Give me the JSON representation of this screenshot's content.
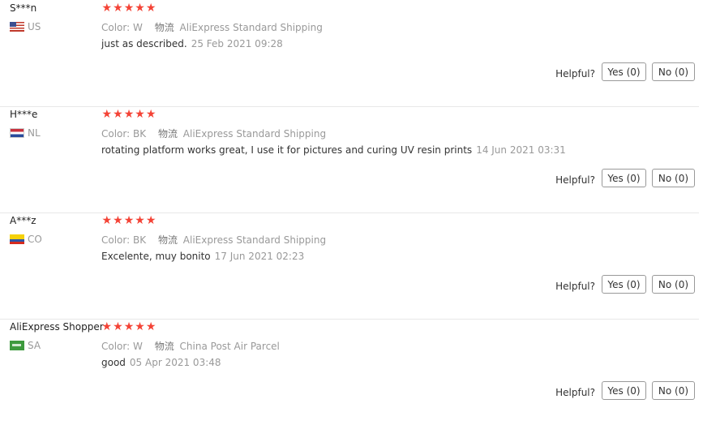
{
  "labels": {
    "color": "Color:",
    "logistics": "物流",
    "helpful": "Helpful?"
  },
  "colors": {
    "star": "#f44336",
    "muted": "#999999",
    "border": "#999999",
    "separator": "#e8e8e8"
  },
  "reviews": [
    {
      "user": "S***n",
      "country": "US",
      "flag_icon": "us-flag-icon",
      "stars": 5,
      "color": "W",
      "shipping": "AliExpress Standard Shipping",
      "text": "just as described.",
      "date": "25 Feb 2021 09:28",
      "yes": "Yes (0)",
      "no": "No (0)"
    },
    {
      "user": "H***e",
      "country": "NL",
      "flag_icon": "nl-flag-icon",
      "stars": 5,
      "color": "BK",
      "shipping": "AliExpress Standard Shipping",
      "text": "rotating platform works great, I use it for pictures and curing UV resin prints",
      "date": "14 Jun 2021 03:31",
      "yes": "Yes (0)",
      "no": "No (0)"
    },
    {
      "user": "A***z",
      "country": "CO",
      "flag_icon": "co-flag-icon",
      "stars": 5,
      "color": "BK",
      "shipping": "AliExpress Standard Shipping",
      "text": "Excelente, muy bonito",
      "date": "17 Jun 2021 02:23",
      "yes": "Yes (0)",
      "no": "No (0)"
    },
    {
      "user": "AliExpress Shopper",
      "country": "SA",
      "flag_icon": "sa-flag-icon",
      "stars": 5,
      "color": "W",
      "shipping": "China Post Air Parcel",
      "text": "good",
      "date": "05 Apr 2021 03:48",
      "yes": "Yes (0)",
      "no": "No (0)"
    }
  ]
}
